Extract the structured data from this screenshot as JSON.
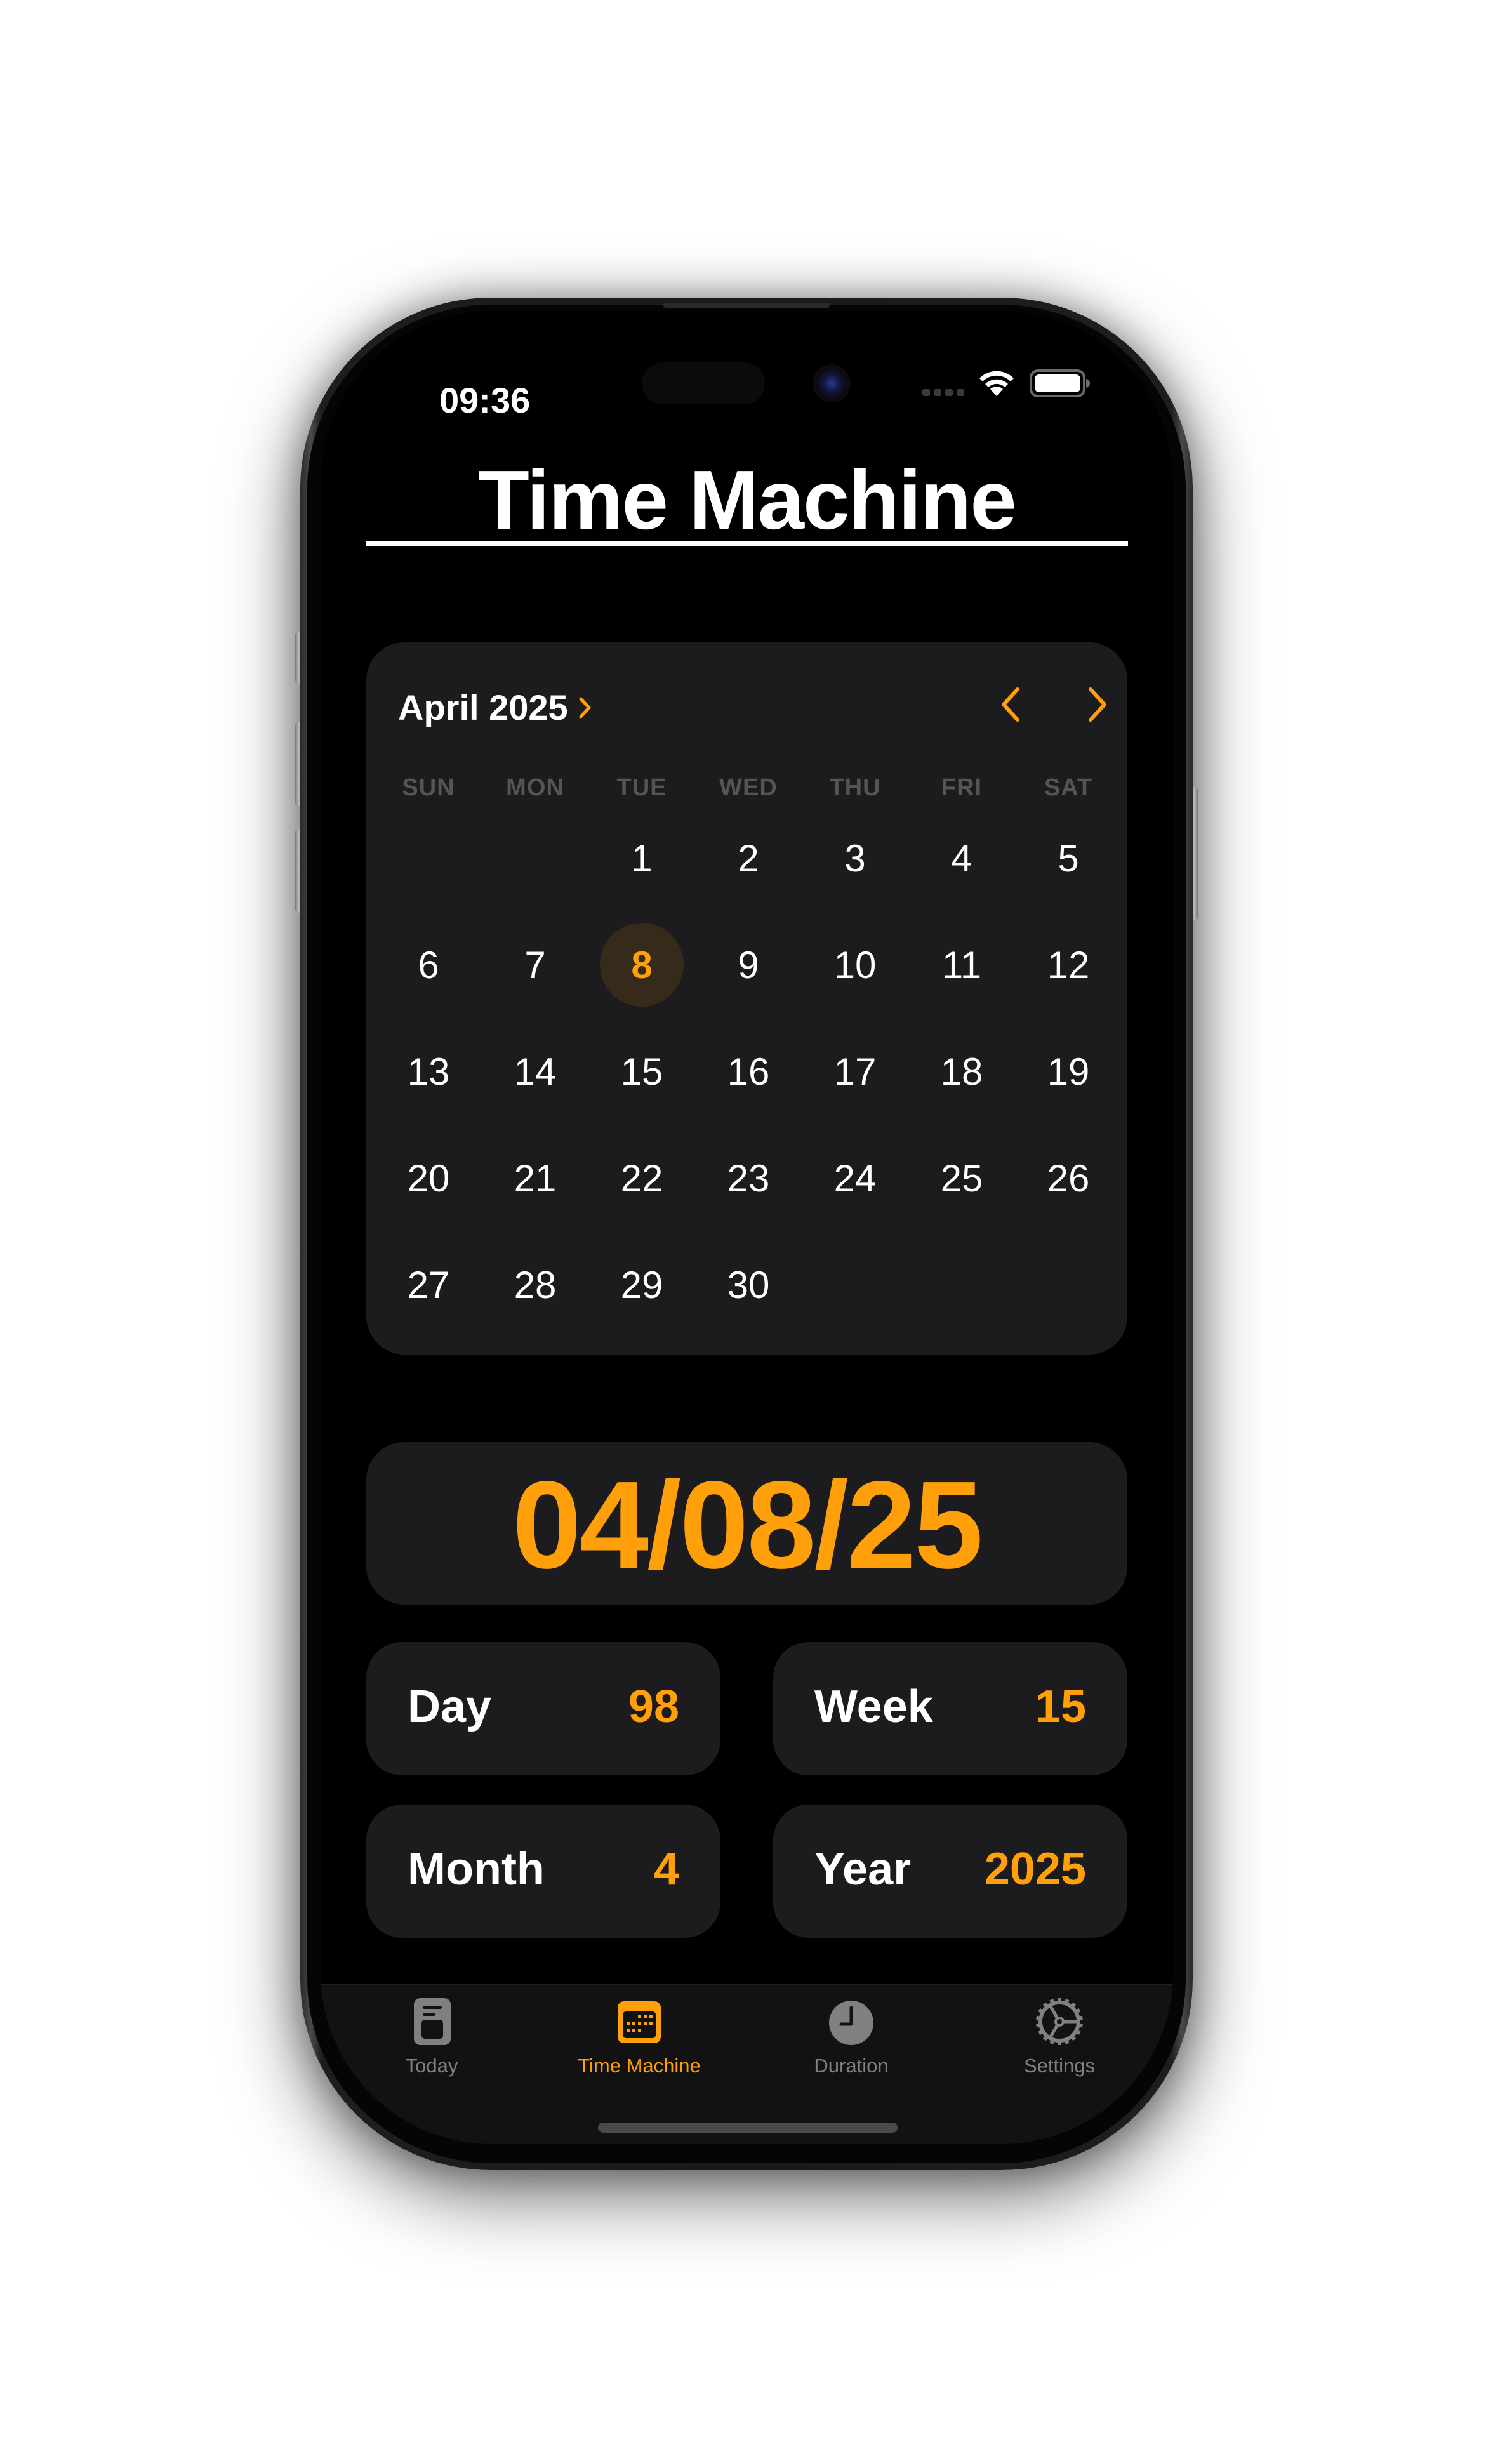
{
  "status_bar": {
    "time": "09:36",
    "signal_icon": "cellular-signal-icon",
    "wifi_icon": "wifi-icon",
    "battery_icon": "battery-full-icon"
  },
  "header": {
    "title": "Time Machine"
  },
  "calendar": {
    "month_label": "April 2025",
    "month_picker_icon": "chevron-right-icon",
    "prev_icon": "chevron-left-icon",
    "next_icon": "chevron-right-icon",
    "weekdays": [
      "SUN",
      "MON",
      "TUE",
      "WED",
      "THU",
      "FRI",
      "SAT"
    ],
    "first_weekday_index": 2,
    "days_in_month": 30,
    "selected_day": 8,
    "days": [
      "1",
      "2",
      "3",
      "4",
      "5",
      "6",
      "7",
      "8",
      "9",
      "10",
      "11",
      "12",
      "13",
      "14",
      "15",
      "16",
      "17",
      "18",
      "19",
      "20",
      "21",
      "22",
      "23",
      "24",
      "25",
      "26",
      "27",
      "28",
      "29",
      "30"
    ]
  },
  "selected_date": {
    "display": "04/08/25"
  },
  "stats": [
    {
      "label": "Day",
      "value": "98"
    },
    {
      "label": "Week",
      "value": "15"
    },
    {
      "label": "Month",
      "value": "4"
    },
    {
      "label": "Year",
      "value": "2025"
    }
  ],
  "tab_bar": {
    "tabs": [
      {
        "label": "Today",
        "icon": "today-doc-icon",
        "active": false
      },
      {
        "label": "Time Machine",
        "icon": "calendar-icon",
        "active": true
      },
      {
        "label": "Duration",
        "icon": "clock-icon",
        "active": false
      },
      {
        "label": "Settings",
        "icon": "gear-icon",
        "active": false
      }
    ]
  },
  "colors": {
    "accent": "#FF9F0A",
    "background": "#000000",
    "card": "#1C1C1E",
    "selected_day_bg": "#362A1A",
    "weekday_text": "#555558",
    "tab_inactive": "#808080",
    "tab_bar_bg": "#121212"
  }
}
